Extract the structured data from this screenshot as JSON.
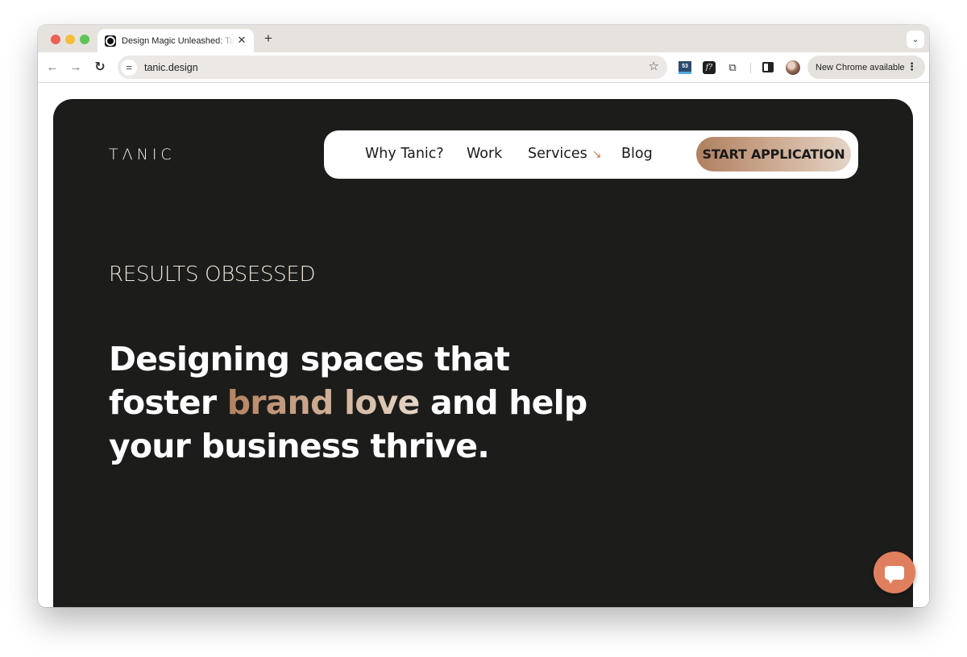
{
  "browser": {
    "tab": {
      "title": "Design Magic Unleashed: Tanic",
      "favicon": "tanic-circle-icon",
      "close_glyph": "✕"
    },
    "new_tab_glyph": "+",
    "tab_menu_glyph": "⌄",
    "nav": {
      "back_glyph": "←",
      "forward_glyph": "→",
      "reload_glyph": "↻"
    },
    "omnibox": {
      "site_info_glyph": "⚌",
      "url": "tanic.design",
      "bookmark_glyph": "☆"
    },
    "extensions": [
      {
        "name": "53-extension-icon",
        "label": "53"
      },
      {
        "name": "f-extension-icon",
        "label": "f?"
      },
      {
        "name": "puzzle-icon",
        "label": "⧉"
      }
    ],
    "update_chip": {
      "label": "New Chrome available",
      "menu_glyph": "⋮"
    }
  },
  "page": {
    "logo": "TΛNIC",
    "nav": {
      "items": [
        {
          "label": "Why Tanic?"
        },
        {
          "label": "Work"
        },
        {
          "label": "Services",
          "arrow": "↘"
        },
        {
          "label": "Blog"
        }
      ],
      "cta_label": "START APPLICATION"
    },
    "hero": {
      "eyebrow": "RESULTS OBSESSED",
      "headline_part1": "Designing spaces that foster ",
      "headline_accent": "brand love",
      "headline_part2": " and help your business thrive."
    },
    "chat_widget": {
      "icon": "chat-bubble-icon"
    },
    "colors": {
      "hero_bg": "#1c1c1a",
      "accent_start": "#b4825f",
      "accent_end": "#e6d6c6",
      "chat_button": "#e07f5e",
      "eyebrow": "#efe6db"
    }
  }
}
